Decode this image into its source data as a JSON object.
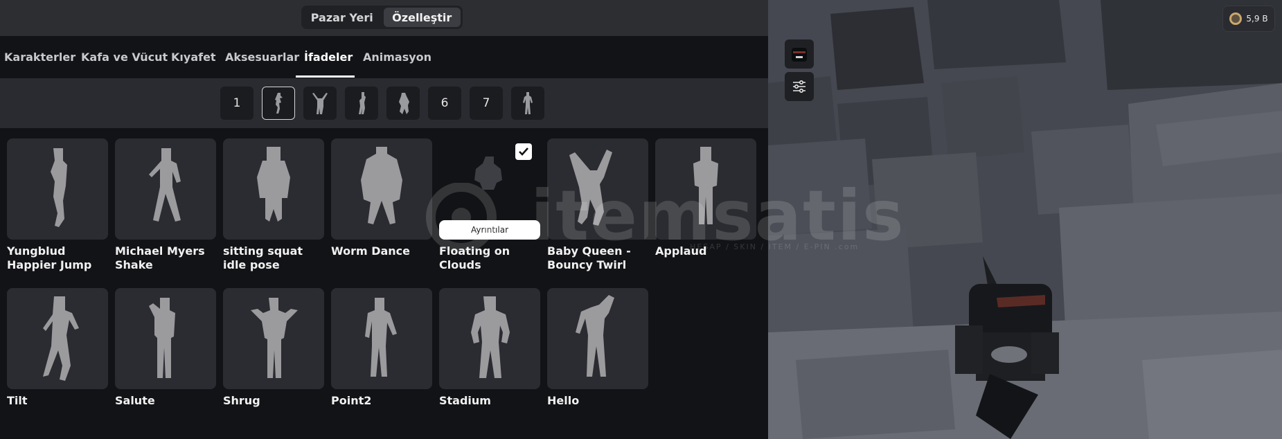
{
  "top_tabs": [
    "Pazar Yeri",
    "Özelleştir"
  ],
  "categories": [
    "Karakterler",
    "Kafa ve Vücut",
    "Kıyafet",
    "Aksesuarlar",
    "İfadeler",
    "Animasyon"
  ],
  "active_category": "İfadeler",
  "slots": {
    "s1": "1",
    "s6": "6",
    "s7": "7"
  },
  "emotes": [
    "Yungblud Happier Jump",
    "Michael Myers Shake",
    "sitting squat idle pose",
    "Worm Dance",
    "Floating on Clouds",
    "Baby Queen - Bouncy Twirl",
    "Applaud",
    "Tilt",
    "Salute",
    "Shrug",
    "Point2",
    "Stadium",
    "Hello"
  ],
  "details_label": "Ayrıntılar",
  "currency": {
    "amount": "5,9 B"
  },
  "watermark": {
    "brand": "itemsatis",
    "tagline": "HESAP / SKIN / ITEM / E-PIN",
    "suffix": ".com"
  },
  "colors": {
    "bg": "#121316",
    "card": "#2b2c31",
    "accent": "#ffffff",
    "coin": "#c9a86a"
  }
}
